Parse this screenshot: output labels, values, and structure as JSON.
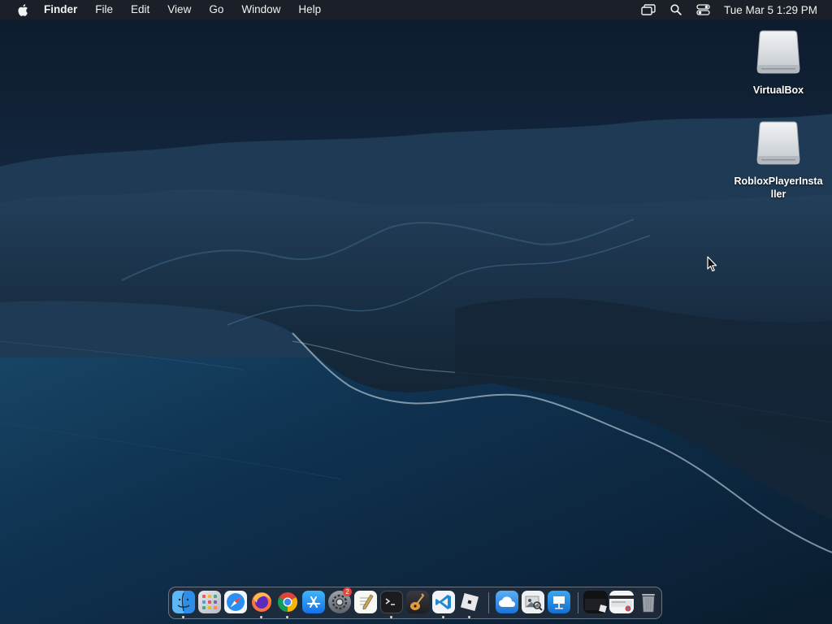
{
  "menubar": {
    "app_name": "Finder",
    "menus": [
      "File",
      "Edit",
      "View",
      "Go",
      "Window",
      "Help"
    ],
    "clock": "Tue Mar 5  1:29 PM",
    "status_icons": [
      "screen-mirroring-icon",
      "spotlight-search-icon",
      "control-center-icon"
    ]
  },
  "desktop": {
    "icons": [
      {
        "label": "VirtualBox",
        "icon": "external-disk-icon"
      },
      {
        "label": "RobloxPlayerInstaller",
        "icon": "external-disk-icon"
      }
    ]
  },
  "dock": {
    "apps": [
      {
        "name": "finder-icon",
        "running": true
      },
      {
        "name": "launchpad-icon",
        "running": false
      },
      {
        "name": "safari-icon",
        "running": false
      },
      {
        "name": "firefox-icon",
        "running": true
      },
      {
        "name": "chrome-icon",
        "running": true
      },
      {
        "name": "app-store-icon",
        "running": false
      },
      {
        "name": "system-settings-icon",
        "running": false,
        "badge": "2"
      },
      {
        "name": "textedit-icon",
        "running": false
      },
      {
        "name": "terminal-icon",
        "running": true
      },
      {
        "name": "garageband-icon",
        "running": false
      },
      {
        "name": "vscode-icon",
        "running": true
      },
      {
        "name": "roblox-icon",
        "running": true
      },
      {
        "name": "icloud-drive-icon",
        "running": false
      },
      {
        "name": "preview-icon",
        "running": false
      },
      {
        "name": "keynote-icon",
        "running": false
      },
      {
        "name": "recent-window-1-icon",
        "running": false
      },
      {
        "name": "recent-window-2-icon",
        "running": false
      },
      {
        "name": "trash-icon",
        "running": false
      }
    ]
  },
  "colors": {
    "menubar_bg": "#1b1f27",
    "badge": "#e5443c",
    "wallpaper_sea": "#0e2a44"
  }
}
